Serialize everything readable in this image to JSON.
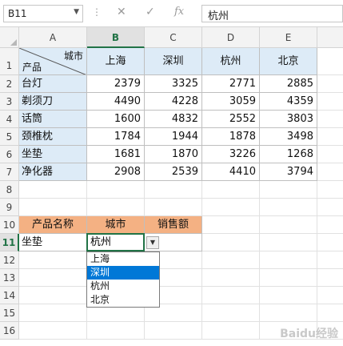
{
  "formula_bar": {
    "name_box": "B11",
    "cancel_glyph": "✕",
    "enter_glyph": "✓",
    "fx_label": "fx",
    "content": "杭州"
  },
  "columns": [
    "A",
    "B",
    "C",
    "D",
    "E"
  ],
  "rows": [
    "1",
    "2",
    "3",
    "4",
    "5",
    "6",
    "7",
    "8",
    "9",
    "10",
    "11",
    "12",
    "13",
    "14",
    "15",
    "16"
  ],
  "table": {
    "header_diag_top": "城市",
    "header_diag_bottom": "产品",
    "cities": [
      "上海",
      "深圳",
      "杭州",
      "北京"
    ],
    "products": [
      {
        "name": "台灯",
        "values": [
          "2379",
          "3325",
          "2771",
          "2885"
        ]
      },
      {
        "name": "剃须刀",
        "values": [
          "4490",
          "4228",
          "3059",
          "4359"
        ]
      },
      {
        "name": "话筒",
        "values": [
          "1600",
          "4832",
          "2552",
          "3803"
        ]
      },
      {
        "name": "颈椎枕",
        "values": [
          "1784",
          "1944",
          "1878",
          "3498"
        ]
      },
      {
        "name": "坐垫",
        "values": [
          "1681",
          "1870",
          "3226",
          "1268"
        ]
      },
      {
        "name": "净化器",
        "values": [
          "2908",
          "2539",
          "4410",
          "3794"
        ]
      }
    ]
  },
  "lookup": {
    "headers": [
      "产品名称",
      "城市",
      "销售额"
    ],
    "product_value": "坐垫",
    "city_value": "杭州",
    "result_value": ""
  },
  "dropdown": {
    "options": [
      "上海",
      "深圳",
      "杭州",
      "北京"
    ],
    "highlighted_index": 1,
    "highlight_color": "#0078d7"
  },
  "colors": {
    "header_fill": "#ddebf7",
    "lookup_header_fill": "#f4b183",
    "selection": "#217346"
  },
  "watermark": "Baidu经验"
}
